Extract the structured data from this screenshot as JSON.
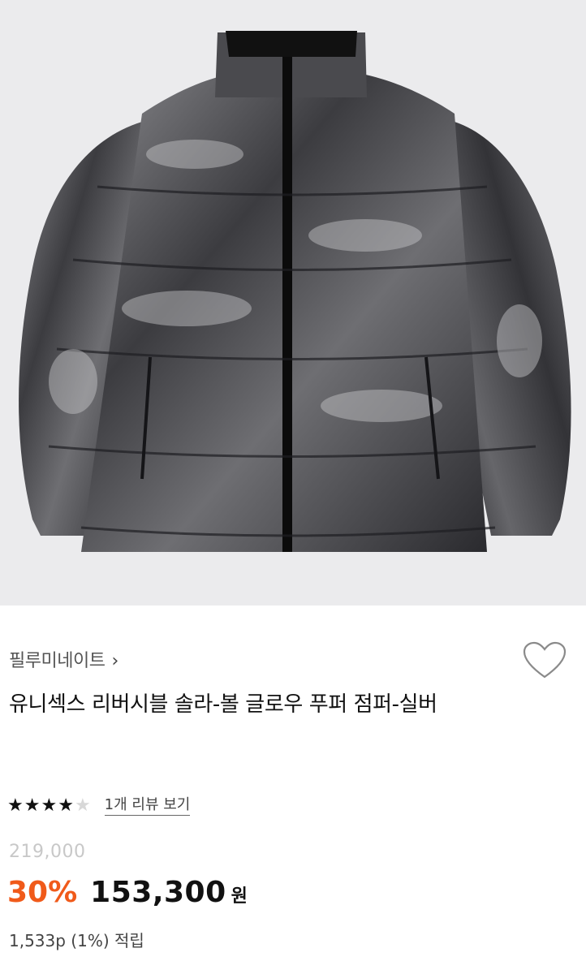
{
  "product": {
    "image_alt": "silver puffer jacket",
    "brand": "필루미네이트",
    "brand_chevron": "›",
    "title": "유니섹스 리버시블 솔라-볼 글로우 푸퍼 점퍼-실버",
    "rating": {
      "filled": 4,
      "total": 5
    },
    "review_link": "1개 리뷰 보기",
    "original_price": "219,000",
    "discount": "30%",
    "price": "153,300",
    "currency": "원",
    "points": "1,533p (1%) 적립"
  },
  "icons": {
    "wishlist": "heart-outline-icon",
    "star": "star-icon"
  },
  "colors": {
    "discount": "#f05a1a",
    "original_price": "#c8c8c8",
    "background_hero": "#ebebed",
    "star_filled": "#111111",
    "star_empty": "#d8d8d8"
  }
}
